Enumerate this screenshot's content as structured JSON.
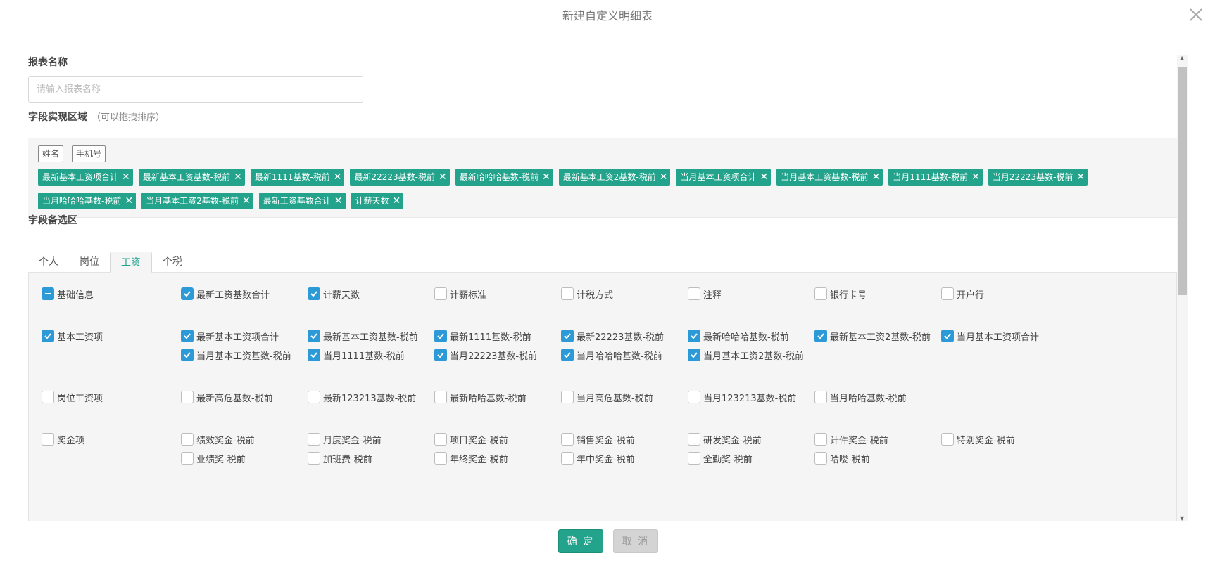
{
  "dialog": {
    "title": "新建自定义明细表",
    "close_icon": "close-icon"
  },
  "report_name": {
    "label": "报表名称",
    "placeholder": "请输入报表名称",
    "value": ""
  },
  "field_area": {
    "label": "字段实现区域",
    "hint": "（可以拖拽排序）",
    "fixed_tags": [
      "姓名",
      "手机号"
    ],
    "selected_tags": [
      "最新基本工资项合计",
      "最新基本工资基数-税前",
      "最新1111基数-税前",
      "最新22223基数-税前",
      "最新哈哈哈基数-税前",
      "最新基本工资2基数-税前",
      "当月基本工资项合计",
      "当月基本工资基数-税前",
      "当月1111基数-税前",
      "当月22223基数-税前",
      "当月哈哈哈基数-税前",
      "当月基本工资2基数-税前",
      "最新工资基数合计",
      "计薪天数"
    ]
  },
  "candidate_area": {
    "label": "字段备选区",
    "tabs": [
      "个人",
      "岗位",
      "工资",
      "个税"
    ],
    "active_tab": "工资",
    "groups": [
      {
        "name": "基础信息",
        "state": "partial",
        "items": [
          {
            "label": "最新工资基数合计",
            "checked": true
          },
          {
            "label": "计薪天数",
            "checked": true
          },
          {
            "label": "计薪标准",
            "checked": false
          },
          {
            "label": "计税方式",
            "checked": false
          },
          {
            "label": "注释",
            "checked": false
          },
          {
            "label": "银行卡号",
            "checked": false
          },
          {
            "label": "开户行",
            "checked": false
          }
        ]
      },
      {
        "name": "基本工资项",
        "state": "checked",
        "items": [
          {
            "label": "最新基本工资项合计",
            "checked": true
          },
          {
            "label": "最新基本工资基数-税前",
            "checked": true
          },
          {
            "label": "最新1111基数-税前",
            "checked": true
          },
          {
            "label": "最新22223基数-税前",
            "checked": true
          },
          {
            "label": "最新哈哈哈基数-税前",
            "checked": true
          },
          {
            "label": "最新基本工资2基数-税前",
            "checked": true
          },
          {
            "label": "当月基本工资项合计",
            "checked": true
          },
          {
            "label": "当月基本工资基数-税前",
            "checked": true
          },
          {
            "label": "当月1111基数-税前",
            "checked": true
          },
          {
            "label": "当月22223基数-税前",
            "checked": true
          },
          {
            "label": "当月哈哈哈基数-税前",
            "checked": true
          },
          {
            "label": "当月基本工资2基数-税前",
            "checked": true
          }
        ]
      },
      {
        "name": "岗位工资项",
        "state": "unchecked",
        "items": [
          {
            "label": "最新高危基数-税前",
            "checked": false
          },
          {
            "label": "最新123213基数-税前",
            "checked": false
          },
          {
            "label": "最新哈哈基数-税前",
            "checked": false
          },
          {
            "label": "当月高危基数-税前",
            "checked": false
          },
          {
            "label": "当月123213基数-税前",
            "checked": false
          },
          {
            "label": "当月哈哈基数-税前",
            "checked": false
          }
        ]
      },
      {
        "name": "奖金项",
        "state": "unchecked",
        "items": [
          {
            "label": "绩效奖金-税前",
            "checked": false
          },
          {
            "label": "月度奖金-税前",
            "checked": false
          },
          {
            "label": "项目奖金-税前",
            "checked": false
          },
          {
            "label": "销售奖金-税前",
            "checked": false
          },
          {
            "label": "研发奖金-税前",
            "checked": false
          },
          {
            "label": "计件奖金-税前",
            "checked": false
          },
          {
            "label": "特别奖金-税前",
            "checked": false
          },
          {
            "label": "业绩奖-税前",
            "checked": false
          },
          {
            "label": "加班费-税前",
            "checked": false
          },
          {
            "label": "年终奖金-税前",
            "checked": false
          },
          {
            "label": "年中奖金-税前",
            "checked": false
          },
          {
            "label": "全勤奖-税前",
            "checked": false
          },
          {
            "label": "哈喽-税前",
            "checked": false
          }
        ]
      }
    ]
  },
  "footer": {
    "confirm_label": "确 定",
    "cancel_label": "取 消"
  },
  "colors": {
    "accent": "#23a38b",
    "checkbox": "#2d9ad8"
  }
}
